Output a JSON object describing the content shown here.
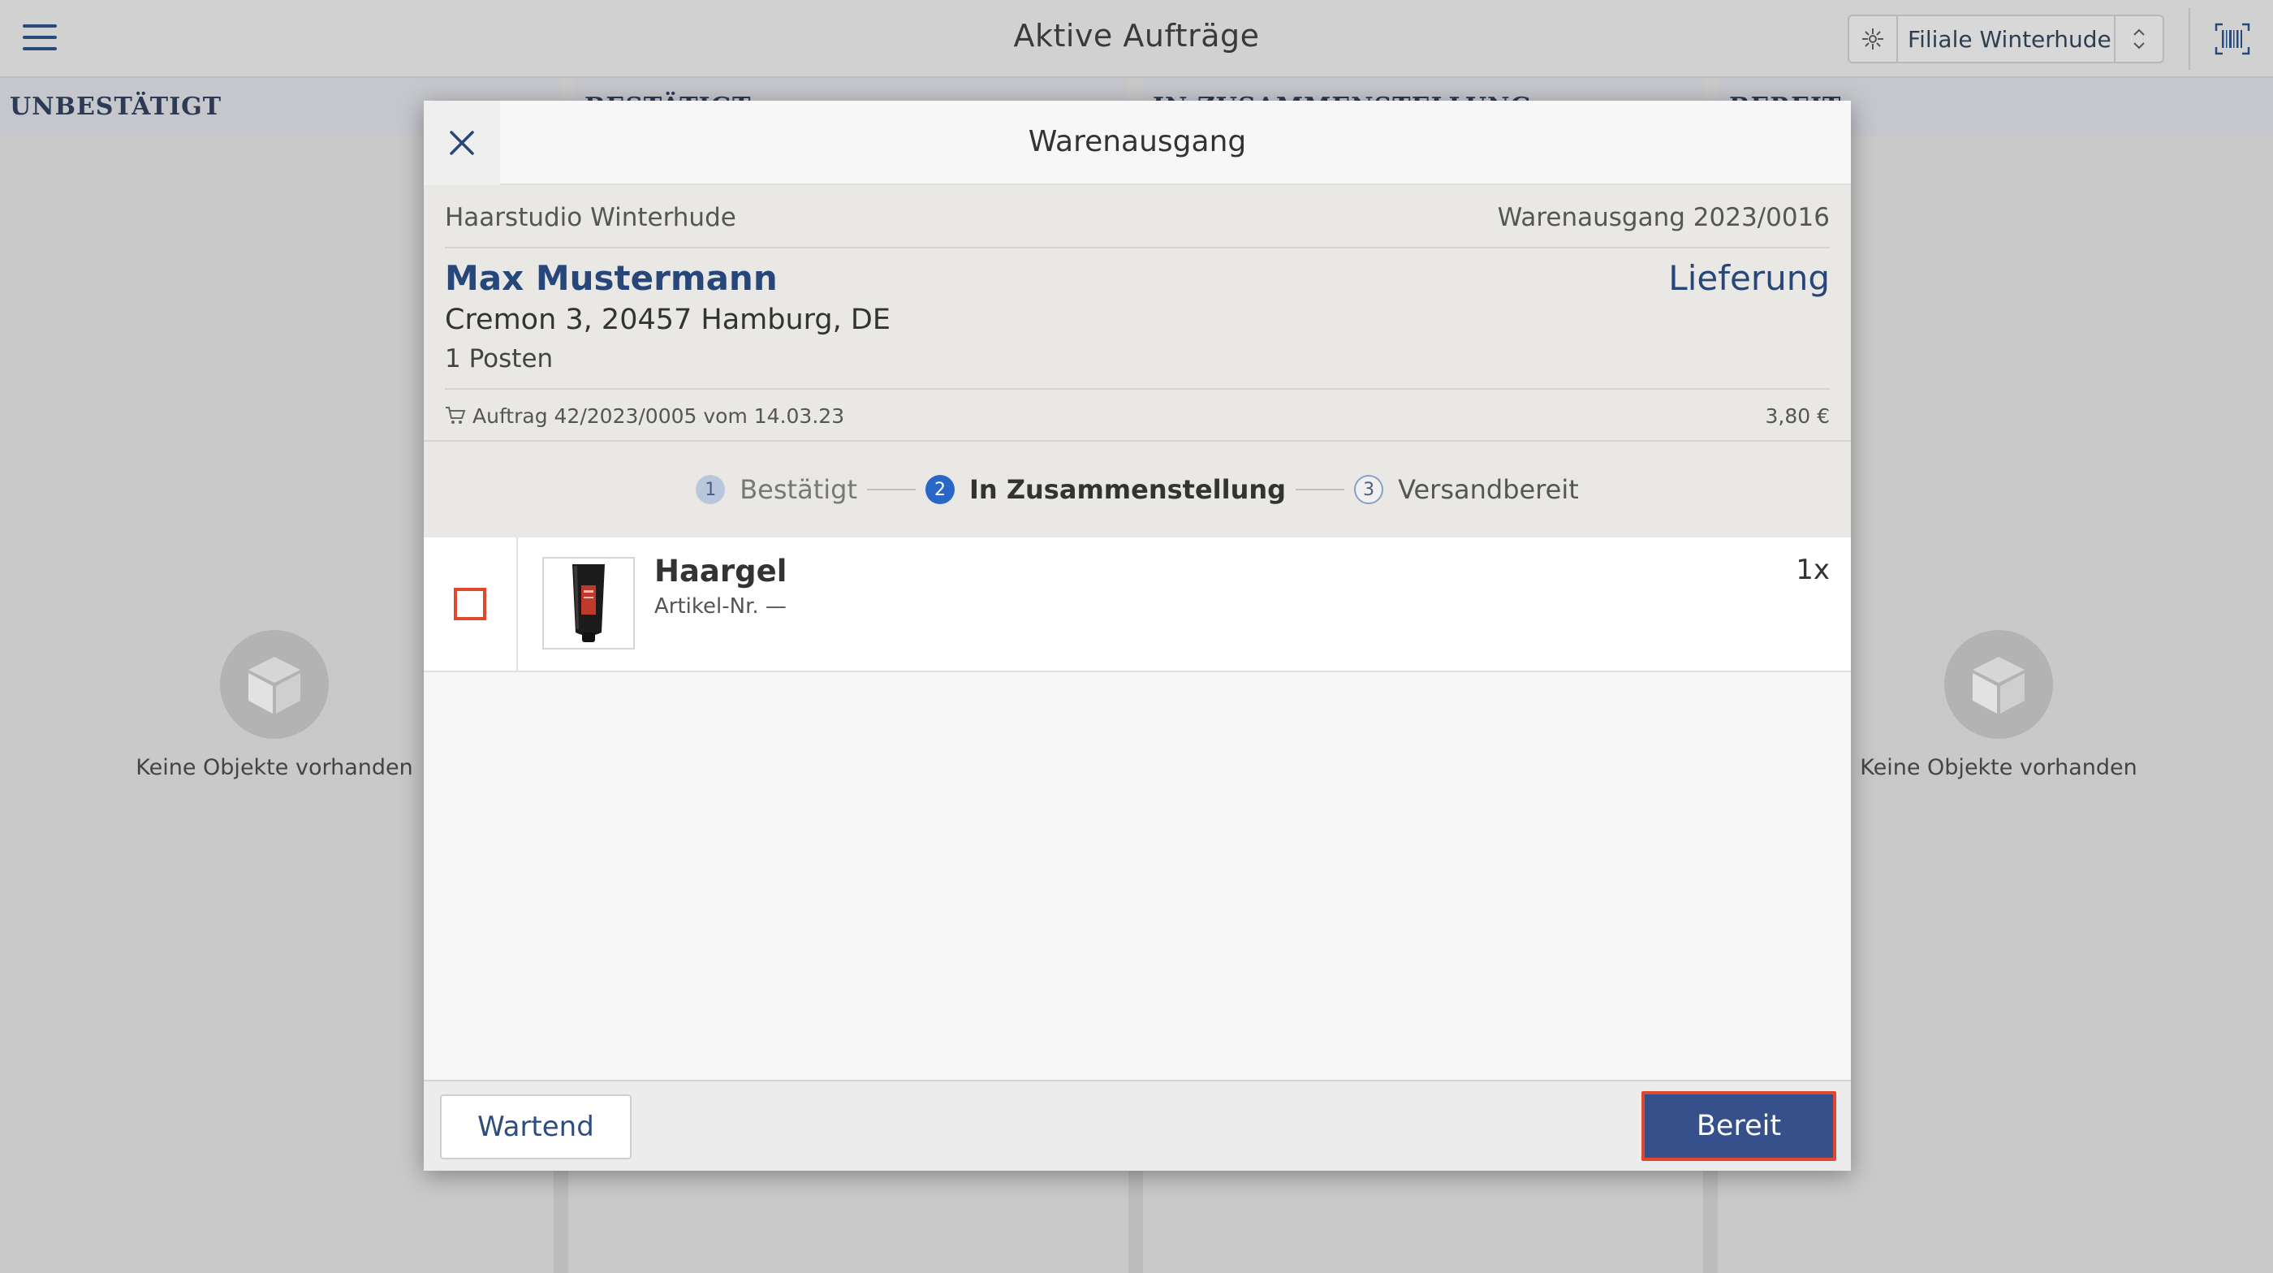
{
  "app": {
    "title": "Aktive Aufträge",
    "branch_label": "Filiale Winterhude"
  },
  "board": {
    "columns": [
      {
        "label": "UNBESTÄTIGT",
        "empty_text": "Keine Objekte vorhanden"
      },
      {
        "label": "BESTÄTIGT"
      },
      {
        "label": "IN ZUSAMMENSTELLUNG"
      },
      {
        "label": "BEREIT",
        "empty_text": "Keine Objekte vorhanden"
      }
    ]
  },
  "modal": {
    "title": "Warenausgang",
    "store_name": "Haarstudio Winterhude",
    "document_number": "Warenausgang 2023/0016",
    "customer_name": "Max Mustermann",
    "delivery_type": "Lieferung",
    "address": "Cremon 3, 20457 Hamburg, DE",
    "positions": "1 Posten",
    "order_ref": "Auftrag 42/2023/0005 vom 14.03.23",
    "order_total": "3,80 €",
    "steps": [
      {
        "num": "1",
        "label": "Bestätigt",
        "state": "done"
      },
      {
        "num": "2",
        "label": "In Zusammenstellung",
        "state": "active"
      },
      {
        "num": "3",
        "label": "Versandbereit",
        "state": "todo"
      }
    ],
    "items": [
      {
        "name": "Haargel",
        "sku": "Artikel-Nr. —",
        "qty": "1x",
        "checked": false
      }
    ],
    "footer": {
      "wait_label": "Wartend",
      "ready_label": "Bereit"
    }
  },
  "colors": {
    "accent": "#27467a",
    "active_step": "#2867c8",
    "primary_button": "#35508a",
    "highlight_border": "#e0472f"
  }
}
